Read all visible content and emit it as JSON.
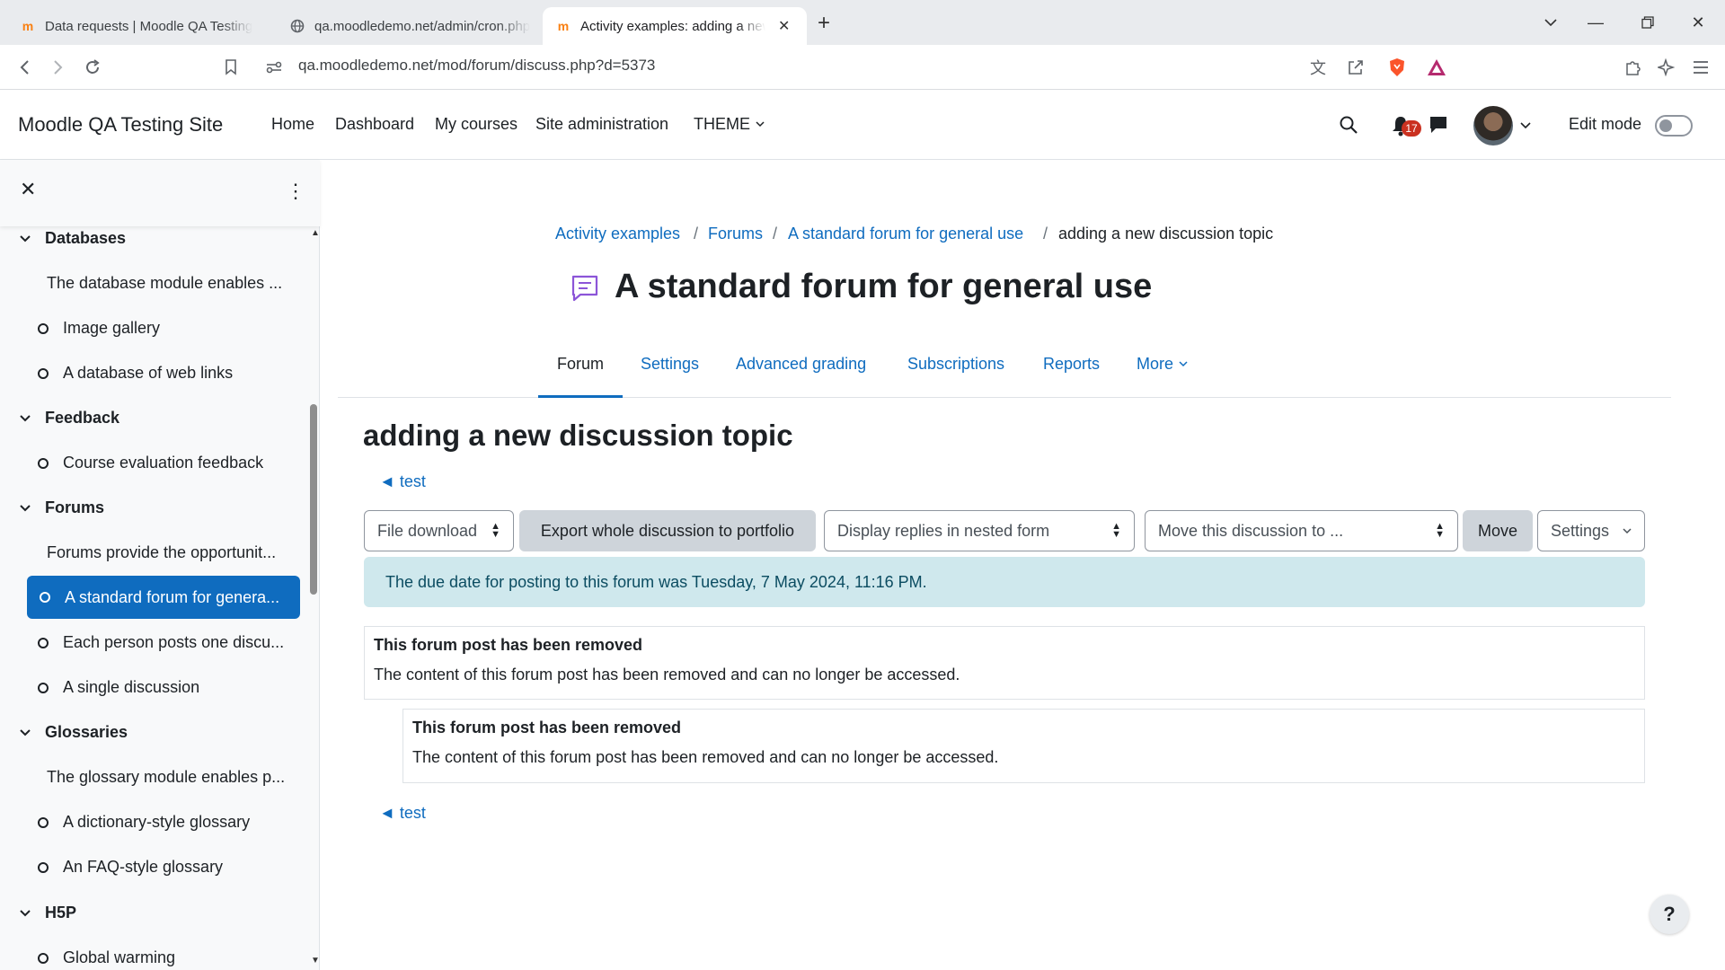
{
  "browser": {
    "tabs": [
      {
        "label": "Data requests | Moodle QA Testing"
      },
      {
        "label": "qa.moodledemo.net/admin/cron.php"
      },
      {
        "label": "Activity examples: adding a new discussion topic"
      }
    ],
    "url": "qa.moodledemo.net/mod/forum/discuss.php?d=5373"
  },
  "header": {
    "site_name": "Moodle QA Testing Site",
    "nav": [
      "Home",
      "Dashboard",
      "My courses",
      "Site administration",
      "THEME"
    ],
    "notification_count": "17",
    "edit_mode_label": "Edit mode"
  },
  "drawer": {
    "sections": {
      "databases": "Databases",
      "feedback": "Feedback",
      "forums": "Forums",
      "glossaries": "Glossaries",
      "h5p": "H5P"
    },
    "databases_desc": "The database module enables ...",
    "image_gallery": "Image gallery",
    "web_links": "A database of web links",
    "course_eval": "Course evaluation feedback",
    "forums_desc": "Forums provide the opportunit...",
    "standard_forum": "A standard forum for genera...",
    "each_person": "Each person posts one discu...",
    "single_discussion": "A single discussion",
    "glossary_desc": "The glossary module enables p...",
    "dictionary_glossary": "A dictionary-style glossary",
    "faq_glossary": "An FAQ-style glossary",
    "global_warming": "Global warming"
  },
  "breadcrumb": [
    "Activity examples",
    "Forums",
    "A standard forum for general use",
    "adding a new discussion topic"
  ],
  "page_title": "A standard forum for general use",
  "secondary_tabs": [
    "Forum",
    "Settings",
    "Advanced grading",
    "Subscriptions",
    "Reports",
    "More"
  ],
  "discussion": {
    "title": "adding a new discussion topic",
    "back_link": "◄ test",
    "controls": {
      "file_download": "File download",
      "export": "Export whole discussion to portfolio",
      "display_mode": "Display replies in nested form",
      "move_to": "Move this discussion to ...",
      "move": "Move",
      "settings": "Settings"
    },
    "alert": "The due date for posting to this forum was Tuesday, 7 May 2024, 11:16 PM.",
    "posts": [
      {
        "title": "This forum post has been removed",
        "body": "The content of this forum post has been removed and can no longer be accessed."
      },
      {
        "title": "This forum post has been removed",
        "body": "The content of this forum post has been removed and can no longer be accessed."
      }
    ]
  },
  "help_label": "?"
}
